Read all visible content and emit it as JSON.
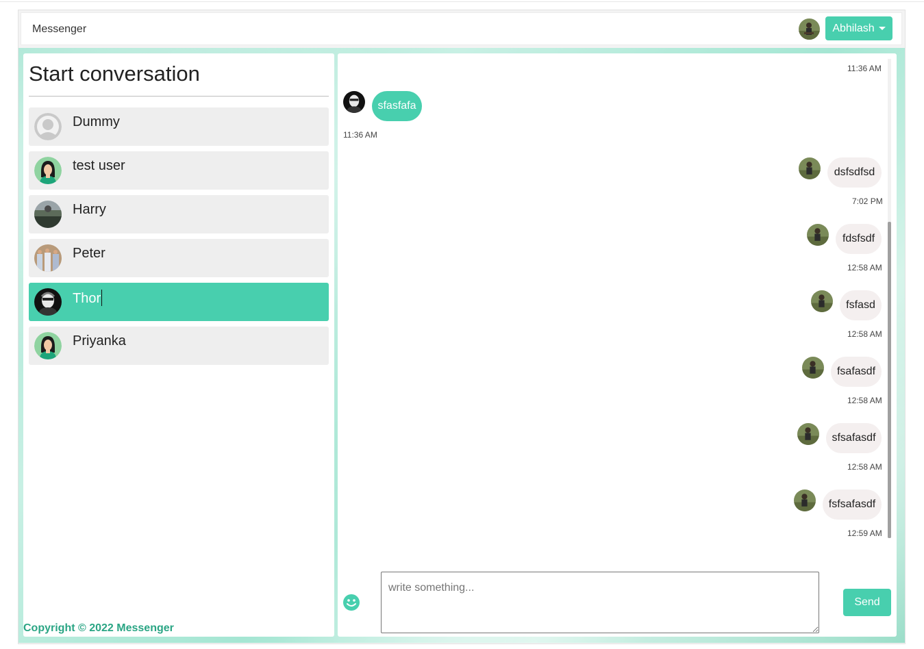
{
  "navbar": {
    "brand": "Messenger",
    "user_name": "Abhilash"
  },
  "left_panel": {
    "title": "Start conversation",
    "contacts": [
      {
        "name": "Dummy",
        "avatar": "default-user-avatar"
      },
      {
        "name": "test user",
        "avatar": "female-avatar"
      },
      {
        "name": "Harry",
        "avatar": "photo-avatar"
      },
      {
        "name": "Peter",
        "avatar": "photo-avatar"
      },
      {
        "name": "Thor",
        "avatar": "photo-avatar",
        "active": true
      },
      {
        "name": "Priyanka",
        "avatar": "female-avatar"
      }
    ],
    "copyright": "Copyright © 2022 Messenger"
  },
  "chat": {
    "messages": [
      {
        "text": "",
        "time": "11:36 AM",
        "direction": "out"
      },
      {
        "text": "sfasfafa",
        "time": "11:36 AM",
        "direction": "in"
      },
      {
        "text": "dsfsdfsd",
        "time": "7:02 PM",
        "direction": "out"
      },
      {
        "text": "fdsfsdf",
        "time": "12:58 AM",
        "direction": "out"
      },
      {
        "text": "fsfasd",
        "time": "12:58 AM",
        "direction": "out"
      },
      {
        "text": "fsafasdf",
        "time": "12:58 AM",
        "direction": "out"
      },
      {
        "text": "sfsafasdf",
        "time": "12:58 AM",
        "direction": "out"
      },
      {
        "text": "fsfsafasdf",
        "time": "12:59 AM",
        "direction": "out"
      }
    ],
    "input_placeholder": "write something...",
    "send_label": "Send",
    "emoji_icon": "smiley-icon"
  },
  "colors": {
    "accent": "#48cfae",
    "copyright": "#2aa584",
    "outgoing_bubble": "#f4efef"
  }
}
